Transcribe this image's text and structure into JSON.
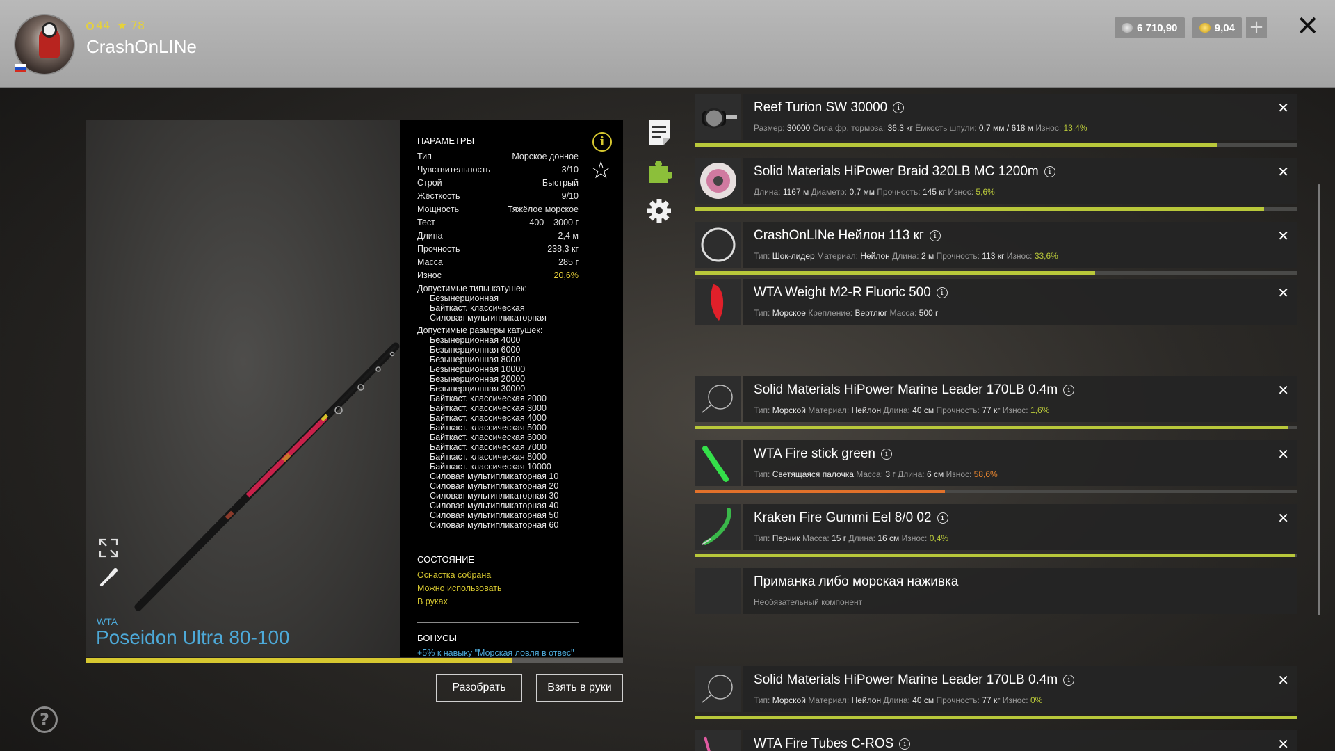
{
  "header": {
    "level": "44",
    "stars": "78",
    "username": "CrashOnLINe",
    "silver": "6 710,90",
    "gold": "9,04",
    "plus": "+",
    "close": "✕"
  },
  "rod": {
    "brand": "WTA",
    "name": "Poseidon Ultra 80-100",
    "durability_fraction": 0.794
  },
  "params": {
    "title": "ПАРАМЕТРЫ",
    "rows": [
      {
        "k": "Тип",
        "v": "Морское донное"
      },
      {
        "k": "Чувствительность",
        "v": "3/10"
      },
      {
        "k": "Строй",
        "v": "Быстрый"
      },
      {
        "k": "Жёсткость",
        "v": "9/10"
      },
      {
        "k": "Мощность",
        "v": "Тяжёлое морское"
      },
      {
        "k": "Тест",
        "v": "400 – 3000 г"
      },
      {
        "k": "Длина",
        "v": "2,4 м"
      },
      {
        "k": "Прочность",
        "v": "238,3 кг"
      },
      {
        "k": "Масса",
        "v": "285 г"
      },
      {
        "k": "Износ",
        "v": "20,6%"
      }
    ],
    "reel_types_title": "Допустимые типы катушек:",
    "reel_types": [
      "Безынерционная",
      "Байткаст. классическая",
      "Силовая мультипликаторная"
    ],
    "reel_sizes_title": "Допустимые размеры катушек:",
    "reel_sizes": [
      "Безынерционная 4000",
      "Безынерционная 6000",
      "Безынерционная 8000",
      "Безынерционная 10000",
      "Безынерционная 20000",
      "Безынерционная 30000",
      "Байткаст. классическая 2000",
      "Байткаст. классическая 3000",
      "Байткаст. классическая 4000",
      "Байткаст. классическая 5000",
      "Байткаст. классическая 6000",
      "Байткаст. классическая 7000",
      "Байткаст. классическая 8000",
      "Байткаст. классическая 10000",
      "Силовая мультипликаторная 10",
      "Силовая мультипликаторная 20",
      "Силовая мультипликаторная 30",
      "Силовая мультипликаторная 40",
      "Силовая мультипликаторная 50",
      "Силовая мультипликаторная 60"
    ],
    "state_title": "СОСТОЯНИЕ",
    "states": [
      "Оснастка собрана",
      "Можно использовать",
      "В руках"
    ],
    "bonus_title": "БОНУСЫ",
    "bonus": "+5% к навыку \"Морская ловля в отвес\""
  },
  "buttons": {
    "disassemble": "Разобрать",
    "take": "Взять в руки"
  },
  "help": "?",
  "components": [
    {
      "title": "Reef Turion SW 30000",
      "details": [
        {
          "k": "Размер:",
          "v": "30000"
        },
        {
          "k": "Сила фр. тормоза:",
          "v": "36,3 кг"
        },
        {
          "k": "Ёмкость шпули:",
          "v": "0,7 мм / 618 м"
        },
        {
          "k": "Износ:",
          "v": "13,4%",
          "wear": true
        }
      ],
      "wear_fraction": 0.866,
      "bar_color": "#b9c83a"
    },
    {
      "title": "Solid Materials HiPower Braid 320LB MC 1200m",
      "details": [
        {
          "k": "Длина:",
          "v": "1167 м"
        },
        {
          "k": "Диаметр:",
          "v": "0,7 мм"
        },
        {
          "k": "Прочность:",
          "v": "145 кг"
        },
        {
          "k": "Износ:",
          "v": "5,6%",
          "wear": true
        }
      ],
      "wear_fraction": 0.944,
      "bar_color": "#b9c83a"
    },
    {
      "title": "CrashOnLINe Нейлон 113 кг",
      "details": [
        {
          "k": "Тип:",
          "v": "Шок-лидер"
        },
        {
          "k": "Материал:",
          "v": "Нейлон"
        },
        {
          "k": "Длина:",
          "v": "2 м"
        },
        {
          "k": "Прочность:",
          "v": "113 кг"
        },
        {
          "k": "Износ:",
          "v": "33,6%",
          "wear": true
        }
      ],
      "wear_fraction": 0.664,
      "bar_color": "#b9c83a"
    },
    {
      "title": "WTA Weight M2-R Fluoric 500",
      "details": [
        {
          "k": "Тип:",
          "v": "Морское"
        },
        {
          "k": "Крепление:",
          "v": "Вертлюг"
        },
        {
          "k": "Масса:",
          "v": "500 г"
        }
      ]
    },
    {
      "title": "Solid Materials HiPower Marine Leader 170LB 0.4m",
      "details": [
        {
          "k": "Тип:",
          "v": "Морской"
        },
        {
          "k": "Материал:",
          "v": "Нейлон"
        },
        {
          "k": "Длина:",
          "v": "40 см"
        },
        {
          "k": "Прочность:",
          "v": "77 кг"
        },
        {
          "k": "Износ:",
          "v": "1,6%",
          "wear": true
        }
      ],
      "wear_fraction": 0.984,
      "bar_color": "#b9c83a"
    },
    {
      "title": "WTA Fire stick green",
      "details": [
        {
          "k": "Тип:",
          "v": "Светящаяся палочка"
        },
        {
          "k": "Масса:",
          "v": "3 г"
        },
        {
          "k": "Длина:",
          "v": "6 см"
        },
        {
          "k": "Износ:",
          "v": "58,6%",
          "wear": true,
          "orange": true
        }
      ],
      "wear_fraction": 0.414,
      "bar_color": "#e2712a"
    },
    {
      "title": "Kraken Fire Gummi Eel 8/0 02",
      "details": [
        {
          "k": "Тип:",
          "v": "Перчик"
        },
        {
          "k": "Масса:",
          "v": "15 г"
        },
        {
          "k": "Длина:",
          "v": "16 см"
        },
        {
          "k": "Износ:",
          "v": "0,4%",
          "wear": true
        }
      ],
      "wear_fraction": 0.996,
      "bar_color": "#b9c83a"
    },
    {
      "title": "Приманка либо морская наживка",
      "subtitle": "Необязательный компонент"
    },
    {
      "title": "Solid Materials HiPower Marine Leader 170LB 0.4m",
      "details": [
        {
          "k": "Тип:",
          "v": "Морской"
        },
        {
          "k": "Материал:",
          "v": "Нейлон"
        },
        {
          "k": "Длина:",
          "v": "40 см"
        },
        {
          "k": "Прочность:",
          "v": "77 кг"
        },
        {
          "k": "Износ:",
          "v": "0%",
          "wear": true
        }
      ],
      "wear_fraction": 1.0,
      "bar_color": "#b9c83a"
    },
    {
      "title": "WTA Fire Tubes C-ROS"
    }
  ],
  "icons": {
    "remove": "✕",
    "info": "i"
  }
}
